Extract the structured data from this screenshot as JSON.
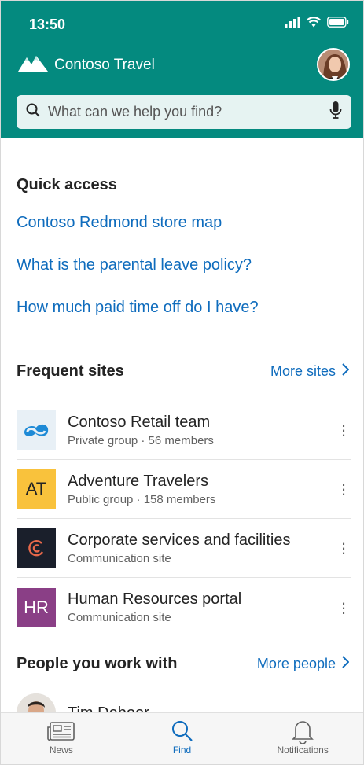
{
  "status_bar": {
    "time": "13:50"
  },
  "header": {
    "brand_name": "Contoso Travel",
    "search_placeholder": "What can we help you find?",
    "accent_color": "#048a7f"
  },
  "quick_access": {
    "title": "Quick access",
    "links": [
      "Contoso Redmond store map",
      "What is the parental leave policy?",
      "How much paid time off do I have?"
    ]
  },
  "frequent_sites": {
    "title": "Frequent sites",
    "more_label": "More sites",
    "items": [
      {
        "name": "Contoso Retail team",
        "meta": "Private group · 56 members",
        "logo_text": "",
        "logo_color": "#e8f0f6"
      },
      {
        "name": "Adventure Travelers",
        "meta": "Public group · 158 members",
        "logo_text": "AT",
        "logo_color": "#f9c23c"
      },
      {
        "name": "Corporate services and facilities",
        "meta": "Communication site",
        "logo_text": "",
        "logo_color": "#1a1f2b"
      },
      {
        "name": "Human Resources portal",
        "meta": "Communication site",
        "logo_text": "HR",
        "logo_color": "#8a3f86"
      }
    ]
  },
  "people": {
    "title": "People you work with",
    "more_label": "More people",
    "items": [
      {
        "name": "Tim Deboer"
      }
    ]
  },
  "bottom_nav": {
    "items": [
      {
        "label": "News",
        "icon": "news-icon",
        "active": false
      },
      {
        "label": "Find",
        "icon": "search-icon",
        "active": true
      },
      {
        "label": "Notifications",
        "icon": "bell-icon",
        "active": false
      }
    ]
  }
}
